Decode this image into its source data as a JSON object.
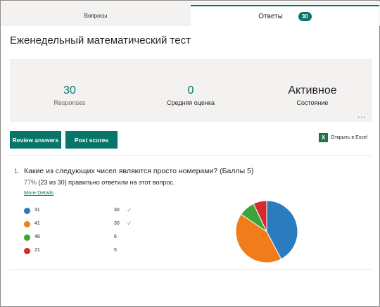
{
  "tabs": {
    "questions_label": "Вопросы",
    "answers_label": "Ответы",
    "answers_count": "30"
  },
  "form": {
    "title": "Еженедельный математический тест"
  },
  "summary": {
    "responses_value": "30",
    "responses_label": "Responses",
    "average_value": "0",
    "average_label": "Средняя оценка",
    "state_value": "Активное",
    "state_label": "Состояние",
    "more_label": "..."
  },
  "actions": {
    "review_label": "Review answers",
    "post_label": "Post scores",
    "excel_label": "Открыть в Excel",
    "excel_icon": "excel-icon"
  },
  "question": {
    "number": "1.",
    "text": "Какие из следующих чисел являются просто номерами? (Баллы 5)",
    "percent": "77%",
    "stat_rest": " (23 из 30) правильно ответили на этот вопрос.",
    "more_details": "More Details",
    "options": [
      {
        "label": "31",
        "count": "30",
        "correct": true,
        "color": "#2b7bbf"
      },
      {
        "label": "41",
        "count": "30",
        "correct": true,
        "color": "#f07d1a"
      },
      {
        "label": "48",
        "count": "6",
        "correct": false,
        "color": "#3aa53a"
      },
      {
        "label": "21",
        "count": "5",
        "correct": false,
        "color": "#d62b2b"
      }
    ],
    "check_glyph": "✓"
  },
  "chart_data": {
    "type": "pie",
    "categories": [
      "31",
      "41",
      "48",
      "21"
    ],
    "values": [
      30,
      30,
      6,
      5
    ],
    "colors": [
      "#2b7bbf",
      "#f07d1a",
      "#3aa53a",
      "#d62b2b"
    ]
  }
}
